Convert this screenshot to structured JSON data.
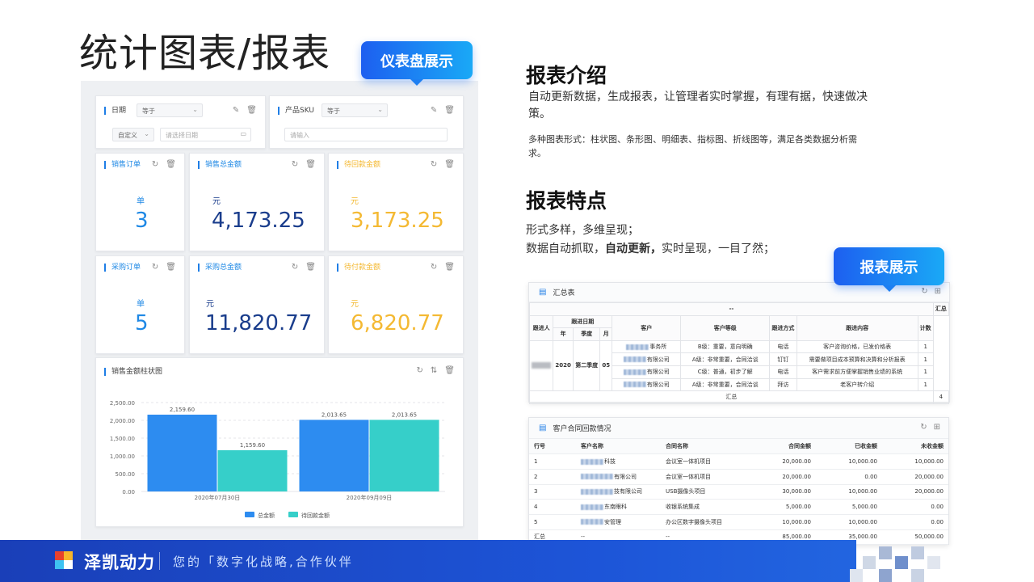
{
  "slide": {
    "title": "统计图表/报表",
    "badge_dashboard": "仪表盘展示",
    "badge_report": "报表展示"
  },
  "intro": {
    "heading": "报表介绍",
    "para1": "自动更新数据，生成报表，让管理者实时掌握，有理有据，快速做决策。",
    "para2": "多种图表形式：柱状图、条形图、明细表、指标图、折线图等，满足各类数据分析需求。"
  },
  "features": {
    "heading": "报表特点",
    "line1": "形式多样，多维呈现；",
    "line2_pre": "数据自动抓取，",
    "line2_bold": "自动更新，",
    "line2_post": "实时呈现，一目了然；"
  },
  "dashboard": {
    "filter_date": {
      "label": "日期",
      "op": "等于",
      "mode": "自定义",
      "placeholder": "请选择日期"
    },
    "filter_sku": {
      "label": "产品SKU",
      "op": "等于",
      "placeholder": "请输入"
    },
    "kpis": [
      {
        "title": "销售订单",
        "unit": "单",
        "value": "3"
      },
      {
        "title": "销售总金额",
        "unit": "元",
        "value": "4,173.25"
      },
      {
        "title": "待回款金额",
        "unit": "元",
        "value": "3,173.25"
      },
      {
        "title": "采购订单",
        "unit": "单",
        "value": "5"
      },
      {
        "title": "采购总金额",
        "unit": "元",
        "value": "11,820.77"
      },
      {
        "title": "待付款金额",
        "unit": "元",
        "value": "6,820.77"
      }
    ],
    "chart_title": "销售金额柱状图"
  },
  "chart_data": {
    "type": "bar",
    "title": "销售金额柱状图",
    "categories": [
      "2020年07月30日",
      "2020年09月09日"
    ],
    "series": [
      {
        "name": "总金额",
        "values": [
          2159.6,
          2013.65
        ],
        "labels": [
          "2,159.60",
          "2,013.65"
        ],
        "color": "#2d8cf0"
      },
      {
        "name": "待回款金额",
        "values": [
          1159.6,
          2013.65
        ],
        "labels": [
          "1,159.60",
          "2,013.65"
        ],
        "color": "#36cfc9"
      }
    ],
    "ylim": [
      0,
      2500
    ],
    "yticks": [
      "0.00",
      "500.00",
      "1,000.00",
      "1,500.00",
      "2,000.00",
      "2,500.00"
    ],
    "grid": true,
    "legend": "bottom-center"
  },
  "summary_table": {
    "title": "汇总表",
    "top_left": "--",
    "top_right": "汇总",
    "headers": {
      "follower": "跟进人",
      "follow_date": "跟进日期",
      "year": "年",
      "quarter": "季度",
      "month": "月",
      "customer": "客户",
      "level": "客户等级",
      "method": "跟进方式",
      "content": "跟进内容",
      "count": "计数"
    },
    "year": "2020",
    "quarter": "第二季度",
    "month": "05",
    "rows": [
      {
        "customer": "事务所",
        "level": "B级：重要，意向明确",
        "method": "电话",
        "content": "客户咨询价格，已发价格表",
        "count": "1"
      },
      {
        "customer": "有限公司",
        "level": "A级：非常重要，合同洽谈",
        "method": "钉钉",
        "content": "需要做项目成本预算和决算和分析报表",
        "count": "1"
      },
      {
        "customer": "有限公司",
        "level": "C级：普通，初步了解",
        "method": "电话",
        "content": "客户需求前方便掌握销售业绩的系统",
        "count": "1"
      },
      {
        "customer": "有限公司",
        "level": "A级：非常重要，合同洽谈",
        "method": "拜访",
        "content": "老客户转介绍",
        "count": "1"
      }
    ],
    "total_label": "汇总",
    "total": "4"
  },
  "contract_table": {
    "title": "客户合同回款情况",
    "headers": [
      "行号",
      "客户名称",
      "合同名称",
      "合同金额",
      "已收金额",
      "未收金额"
    ],
    "rows": [
      [
        "1",
        "科技",
        "会议室一体机项目",
        "20,000.00",
        "10,000.00",
        "10,000.00"
      ],
      [
        "2",
        "有限公司",
        "会议室一体机项目",
        "20,000.00",
        "0.00",
        "20,000.00"
      ],
      [
        "3",
        "技有限公司",
        "USB摄像头项目",
        "30,000.00",
        "10,000.00",
        "20,000.00"
      ],
      [
        "4",
        "东南眼科",
        "收银系统集成",
        "5,000.00",
        "5,000.00",
        "0.00"
      ],
      [
        "5",
        "安管理",
        "办公区数字摄像头项目",
        "10,000.00",
        "10,000.00",
        "0.00"
      ],
      [
        "汇总",
        "--",
        "--",
        "85,000.00",
        "35,000.00",
        "50,000.00"
      ]
    ]
  },
  "footer": {
    "brand": "泽凯动力",
    "slogan": "您的「数字化战略,合作伙伴"
  }
}
